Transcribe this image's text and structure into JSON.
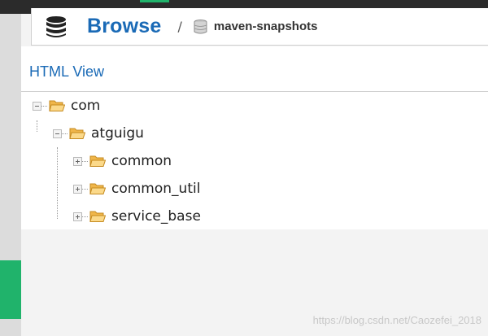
{
  "header": {
    "title": "Browse",
    "separator": "/",
    "repository": "maven-snapshots"
  },
  "view_link": "HTML View",
  "tree": [
    {
      "label": "com",
      "state": "expanded",
      "depth": 0
    },
    {
      "label": "atguigu",
      "state": "expanded",
      "depth": 1
    },
    {
      "label": "common",
      "state": "collapsed",
      "depth": 2
    },
    {
      "label": "common_util",
      "state": "collapsed",
      "depth": 2
    },
    {
      "label": "service_base",
      "state": "collapsed",
      "depth": 2
    }
  ],
  "watermark": "https://blog.csdn.net/Caozefei_2018",
  "colors": {
    "link_blue": "#1a6ab6",
    "accent_green": "#20b36b",
    "folder_yellow": "#f4c86a"
  },
  "icons": {
    "header": "database-icon",
    "repository": "repository-icon",
    "node": "folder-open-icon"
  }
}
